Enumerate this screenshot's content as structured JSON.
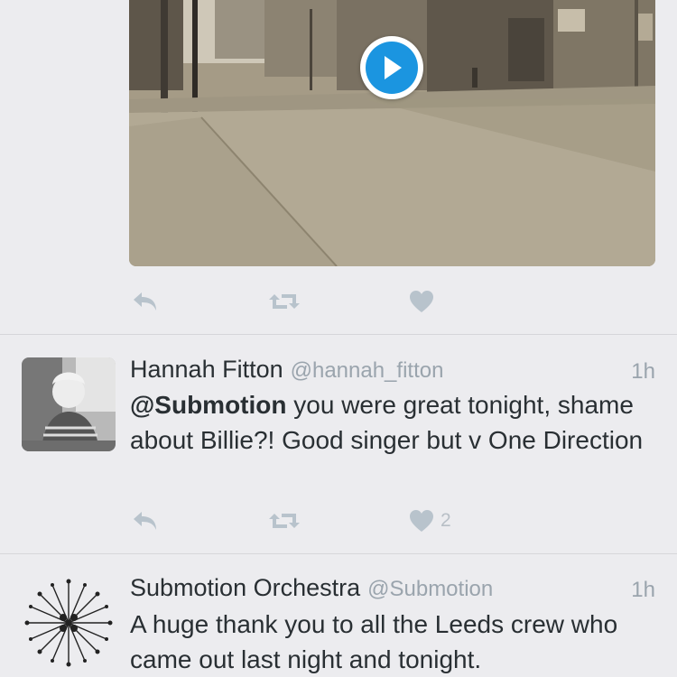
{
  "media": {
    "play_icon": "play-icon"
  },
  "icons": {
    "reply": "reply-icon",
    "retweet": "retweet-icon",
    "like": "heart-icon"
  },
  "colors": {
    "action_icon": "#b8c3cc",
    "link_blue": "#1b95e0",
    "muted": "#9aa4ad"
  },
  "tweets": [
    {
      "name": "Hannah Fitton",
      "handle": "@hannah_fitton",
      "time": "1h",
      "mention": "@Submotion",
      "text": " you were great tonight, shame about Billie?! Good singer but v One Direction",
      "likes": "2"
    },
    {
      "name": "Submotion Orchestra",
      "handle": "@Submotion",
      "time": "1h",
      "text": "A huge thank you to all the Leeds crew who came out last night and tonight."
    }
  ]
}
